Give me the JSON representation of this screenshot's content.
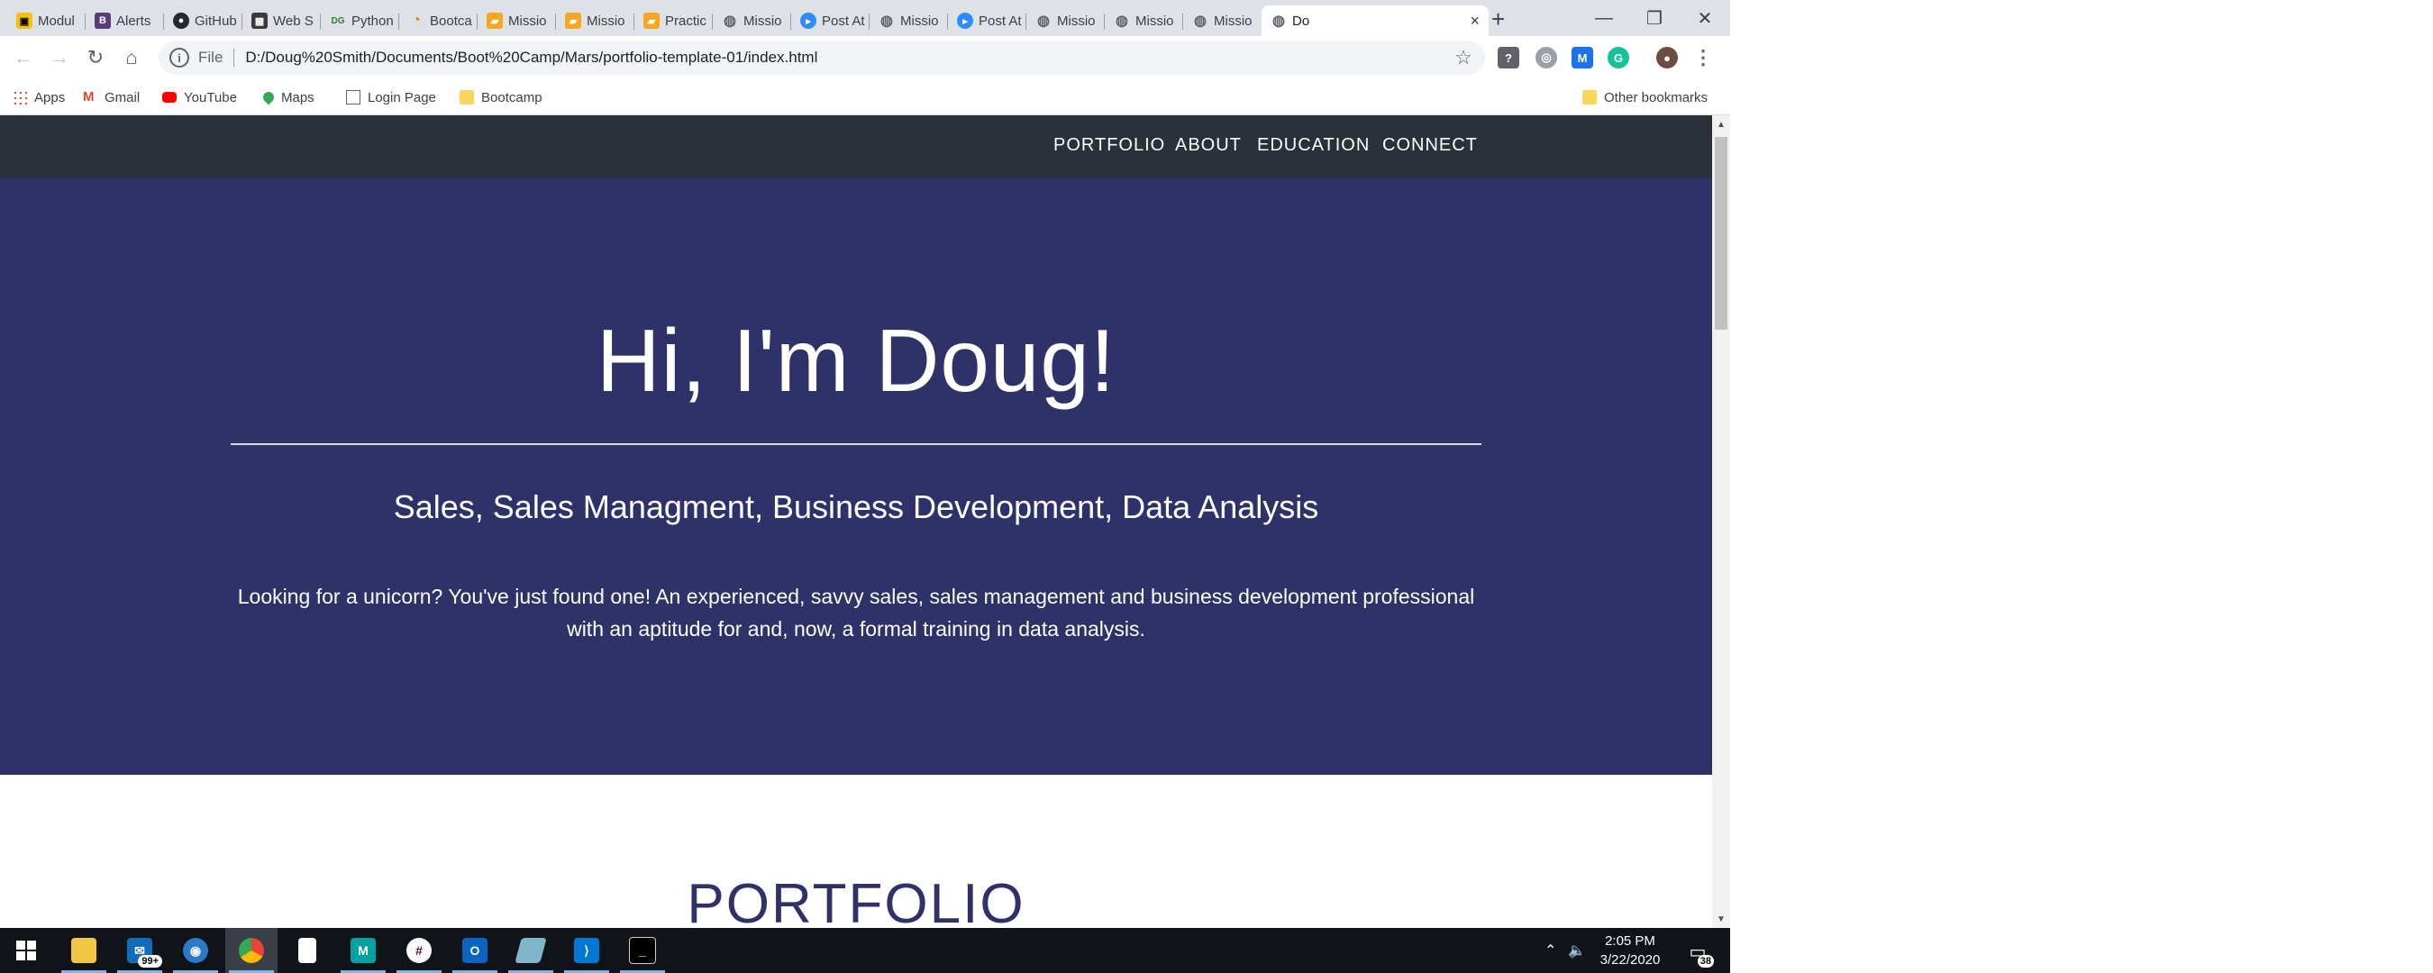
{
  "browser": {
    "tabs": [
      {
        "title": "Modul",
        "icon": "yellow-module-icon",
        "color": "#f4c20d"
      },
      {
        "title": "Alerts",
        "icon": "bootstrap-icon",
        "color": "#563d7c"
      },
      {
        "title": "GitHub",
        "icon": "github-icon",
        "color": "#24292e"
      },
      {
        "title": "Web S",
        "icon": "web-scraping-icon",
        "color": "#3a3a3a"
      },
      {
        "title": "Python",
        "icon": "dg-icon",
        "color": "#2e7d32"
      },
      {
        "title": "Bootca",
        "icon": "bootcamp-icon",
        "color": "#ff6d00"
      },
      {
        "title": "Missio",
        "icon": "slides-icon",
        "color": "#f5a623"
      },
      {
        "title": "Missio",
        "icon": "slides-icon",
        "color": "#f5a623"
      },
      {
        "title": "Practic",
        "icon": "slides-icon",
        "color": "#f5a623"
      },
      {
        "title": "Missio",
        "icon": "globe-icon",
        "color": "#5f6368"
      },
      {
        "title": "Post At",
        "icon": "zoom-icon",
        "color": "#2d8cff"
      },
      {
        "title": "Missio",
        "icon": "globe-icon",
        "color": "#5f6368"
      },
      {
        "title": "Post At",
        "icon": "zoom-icon",
        "color": "#2d8cff"
      },
      {
        "title": "Missio",
        "icon": "globe-icon",
        "color": "#5f6368"
      },
      {
        "title": "Missio",
        "icon": "globe-icon",
        "color": "#5f6368"
      },
      {
        "title": "Missio",
        "icon": "globe-icon",
        "color": "#5f6368"
      },
      {
        "title": "Do",
        "icon": "globe-icon",
        "color": "#5f6368",
        "active": true
      }
    ],
    "new_tab": "+",
    "close_tab": "×",
    "window_controls": {
      "minimize": "—",
      "restore": "❐",
      "close": "✕"
    },
    "address": {
      "scheme_label": "File",
      "url": "D:/Doug%20Smith/Documents/Boot%20Camp/Mars/portfolio-template-01/index.html"
    },
    "bookmarks": [
      {
        "label": "Apps",
        "icon": "apps-grid-icon"
      },
      {
        "label": "Gmail",
        "icon": "gmail-icon"
      },
      {
        "label": "YouTube",
        "icon": "youtube-icon"
      },
      {
        "label": "Maps",
        "icon": "maps-pin-icon"
      },
      {
        "label": "Login Page",
        "icon": "page-icon"
      },
      {
        "label": "Bootcamp",
        "icon": "folder-icon"
      }
    ],
    "other_bookmarks": "Other bookmarks"
  },
  "site": {
    "nav": [
      "PORTFOLIO",
      "ABOUT",
      "EDUCATION",
      "CONNECT"
    ],
    "hero_title": "Hi, I'm Doug!",
    "hero_subtitle": "Sales, Sales Managment, Business Development, Data Analysis",
    "hero_description": "Looking for a unicorn? You've just found one! An experienced, savvy sales, sales management and business development professional with an aptitude for and, now, a formal training in data analysis.",
    "section_heading": "PORTFOLIO",
    "colors": {
      "nav_bg": "#2c3038",
      "hero_bg": "#2f3169",
      "heading": "#2f3169"
    }
  },
  "taskbar": {
    "mail_badge": "99+",
    "time": "2:05 PM",
    "date": "3/22/2020",
    "notification_count": "38"
  }
}
